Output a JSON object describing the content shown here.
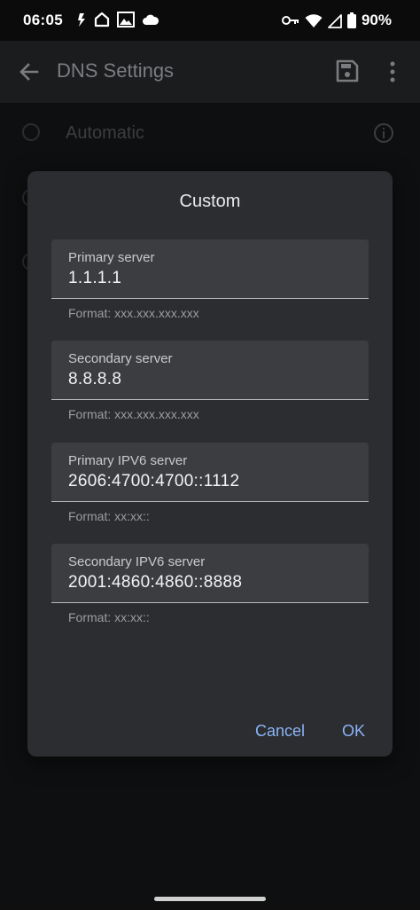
{
  "status_bar": {
    "time": "06:05",
    "battery": "90%",
    "icons": [
      "navigation-icon",
      "home-icon",
      "image-icon",
      "cloud-icon",
      "vpn-key-icon",
      "wifi-icon",
      "signal-icon",
      "battery-icon"
    ]
  },
  "app_bar": {
    "title": "DNS Settings"
  },
  "background_list": {
    "automatic_label": "Automatic"
  },
  "dialog": {
    "title": "Custom",
    "fields": [
      {
        "label": "Primary server",
        "value": "1.1.1.1",
        "help": "Format: xxx.xxx.xxx.xxx"
      },
      {
        "label": "Secondary server",
        "value": "8.8.8.8",
        "help": "Format: xxx.xxx.xxx.xxx"
      },
      {
        "label": "Primary IPV6 server",
        "value": "2606:4700:4700::1112",
        "help": "Format: xx:xx::"
      },
      {
        "label": "Secondary IPV6 server",
        "value": "2001:4860:4860::8888",
        "help": "Format: xx:xx::"
      }
    ],
    "cancel_label": "Cancel",
    "ok_label": "OK"
  },
  "colors": {
    "accent": "#8ab4f8",
    "dialog_bg": "#2c2d30",
    "field_bg": "#3b3d40"
  }
}
